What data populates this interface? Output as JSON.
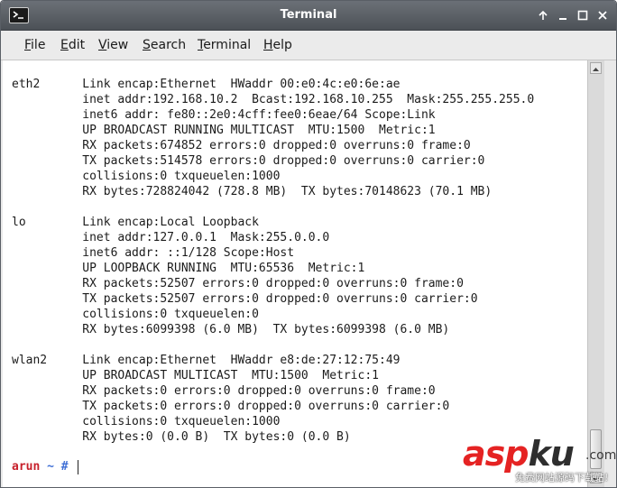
{
  "window": {
    "title": "Terminal"
  },
  "menubar": {
    "items": [
      {
        "underline": "F",
        "rest": "ile"
      },
      {
        "underline": "E",
        "rest": "dit"
      },
      {
        "underline": "V",
        "rest": "iew"
      },
      {
        "underline": "S",
        "rest": "earch"
      },
      {
        "underline": "T",
        "rest": "erminal"
      },
      {
        "underline": "H",
        "rest": "elp"
      }
    ]
  },
  "terminal": {
    "output": "eth2      Link encap:Ethernet  HWaddr 00:e0:4c:e0:6e:ae  \n          inet addr:192.168.10.2  Bcast:192.168.10.255  Mask:255.255.255.0\n          inet6 addr: fe80::2e0:4cff:fee0:6eae/64 Scope:Link\n          UP BROADCAST RUNNING MULTICAST  MTU:1500  Metric:1\n          RX packets:674852 errors:0 dropped:0 overruns:0 frame:0\n          TX packets:514578 errors:0 dropped:0 overruns:0 carrier:0\n          collisions:0 txqueuelen:1000 \n          RX bytes:728824042 (728.8 MB)  TX bytes:70148623 (70.1 MB)\n\nlo        Link encap:Local Loopback  \n          inet addr:127.0.0.1  Mask:255.0.0.0\n          inet6 addr: ::1/128 Scope:Host\n          UP LOOPBACK RUNNING  MTU:65536  Metric:1\n          RX packets:52507 errors:0 dropped:0 overruns:0 frame:0\n          TX packets:52507 errors:0 dropped:0 overruns:0 carrier:0\n          collisions:0 txqueuelen:0 \n          RX bytes:6099398 (6.0 MB)  TX bytes:6099398 (6.0 MB)\n\nwlan2     Link encap:Ethernet  HWaddr e8:de:27:12:75:49  \n          UP BROADCAST MULTICAST  MTU:1500  Metric:1\n          RX packets:0 errors:0 dropped:0 overruns:0 frame:0\n          TX packets:0 errors:0 dropped:0 overruns:0 carrier:0\n          collisions:0 txqueuelen:1000 \n          RX bytes:0 (0.0 B)  TX bytes:0 (0.0 B)",
    "prompt_user": "arun",
    "prompt_dir": "~",
    "prompt_symbol": "#"
  },
  "watermark": {
    "asp": "asp",
    "ku": "ku",
    "com": ".com",
    "subtitle": "免费网站源码下载站!"
  },
  "colors": {
    "titlebar": "#565b62",
    "prompt_user": "#c7202b",
    "prompt_dir": "#3f6fd6",
    "watermark_red": "#e52323"
  }
}
